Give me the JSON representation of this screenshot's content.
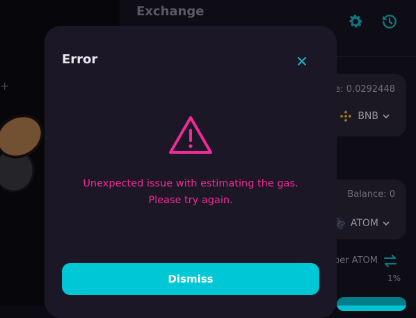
{
  "app": {
    "title": "Exchange",
    "from": {
      "balance": "ce: 0.0292448",
      "token": "BNB"
    },
    "to": {
      "balance": "Balance: 0",
      "token": "ATOM"
    },
    "rate_label": "per ATOM",
    "slippage": "1%"
  },
  "modal": {
    "title": "Error",
    "message_line1": "Unexpected issue with estimating the gas.",
    "message_line2": "Please try again.",
    "dismiss_label": "Dismiss"
  },
  "colors": {
    "accent": "#00c7d6",
    "error": "#f02a97",
    "modal_bg": "#1c1726"
  },
  "icons": {
    "close": "close-icon",
    "warning": "warning-triangle-icon",
    "settings": "gear-icon",
    "history": "history-icon"
  }
}
